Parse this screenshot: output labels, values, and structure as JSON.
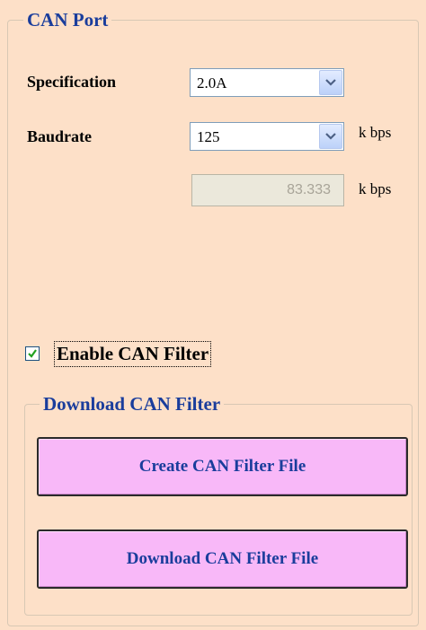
{
  "can_port": {
    "title": "CAN Port",
    "specification": {
      "label": "Specification",
      "selected": "2.0A",
      "dropdown_icon": "chevron-down-icon"
    },
    "baudrate": {
      "label": "Baudrate",
      "selected": "125",
      "unit": "k bps",
      "dropdown_icon": "chevron-down-icon"
    },
    "custom_baudrate": {
      "value": "83.333",
      "unit": "k bps"
    }
  },
  "filter": {
    "enable_label": "Enable CAN Filter",
    "enabled": true
  },
  "download": {
    "title": "Download CAN Filter",
    "create_button": "Create CAN Filter File",
    "download_button": "Download CAN Filter File"
  },
  "colors": {
    "panel_background": "#fde0c8",
    "group_title": "#1a3d9c",
    "button_fill": "#f8b8f8",
    "button_text": "#1a3d9c",
    "disabled_field": "#ebe8db"
  }
}
